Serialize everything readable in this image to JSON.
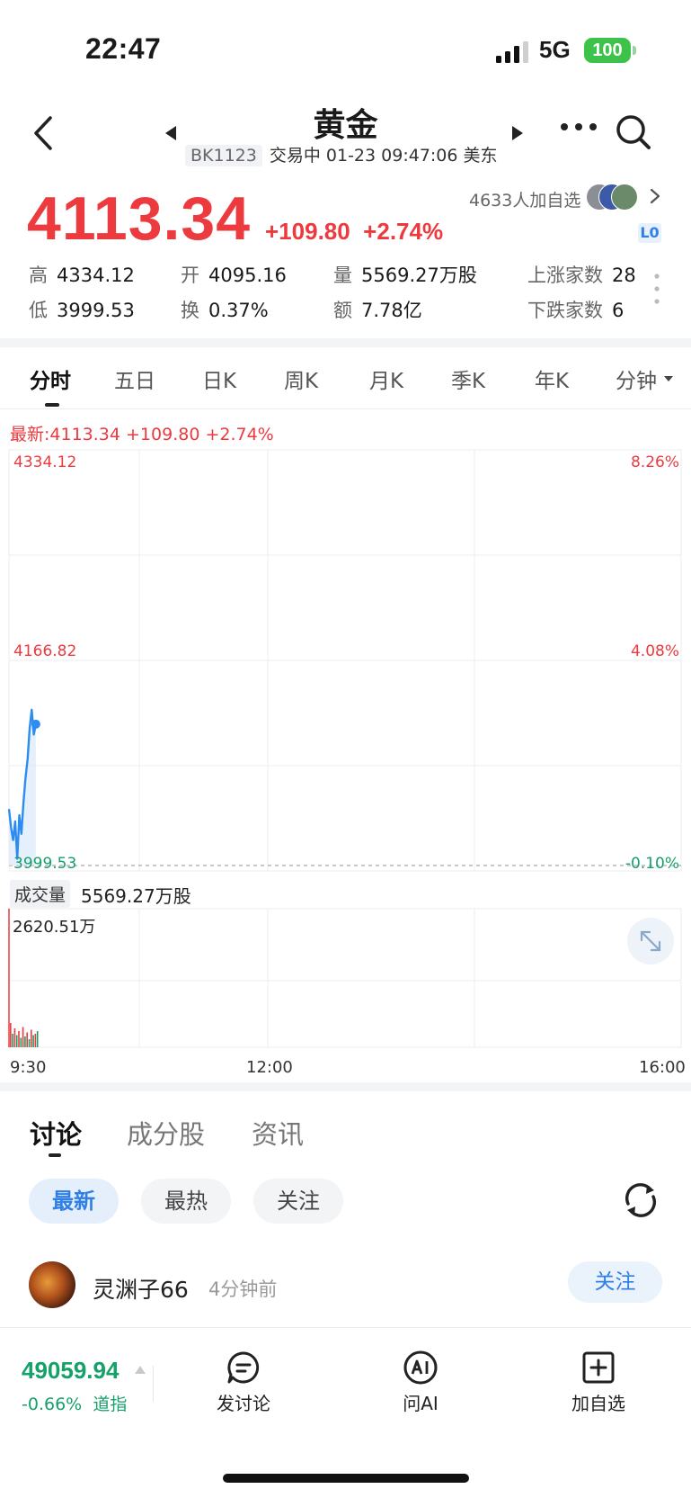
{
  "status_bar": {
    "time": "22:47",
    "network": "5G",
    "battery": "100"
  },
  "header": {
    "title": "黄金",
    "code": "BK1123",
    "status": "交易中 01-23 09:47:06 美东"
  },
  "quote": {
    "price": "4113.34",
    "change": "+109.80",
    "change_pct": "+2.74%",
    "followers": "4633人加自选",
    "level_badge": "L0"
  },
  "stats": {
    "high_label": "高",
    "high": "4334.12",
    "open_label": "开",
    "open": "4095.16",
    "volume_label": "量",
    "volume": "5569.27万股",
    "up_label": "上涨家数",
    "up": "28",
    "low_label": "低",
    "low": "3999.53",
    "turnover_label": "换",
    "turnover": "0.37%",
    "amount_label": "额",
    "amount": "7.78亿",
    "down_label": "下跌家数",
    "down": "6"
  },
  "chart_tabs": [
    "分时",
    "五日",
    "日K",
    "周K",
    "月K",
    "季K",
    "年K",
    "分钟"
  ],
  "latest_line": "最新:4113.34  +109.80  +2.74%",
  "chart_data": {
    "type": "line",
    "price_axis": {
      "top": "4334.12",
      "mid": "4166.82",
      "bottom": "3999.53"
    },
    "pct_axis": {
      "top": "8.26%",
      "mid": "4.08%",
      "bottom": "-0.10%"
    },
    "ylim": [
      3999.53,
      4334.12
    ],
    "x_ticks": [
      "9:30",
      "12:00",
      "16:00"
    ],
    "series": [
      {
        "values": [
          4045,
          4030,
          4020,
          4035,
          4005,
          4040,
          4025,
          4050,
          4070,
          4085,
          4110,
          4125,
          4105,
          4113.34
        ]
      }
    ],
    "volume": {
      "label": "成交量",
      "total": "5569.27万股",
      "max": "2620.51万",
      "bars": [
        18,
        10,
        14,
        9,
        12,
        7,
        15,
        8,
        11,
        6,
        13,
        9,
        10,
        12
      ]
    },
    "colors": {
      "line": "#2d8cf0",
      "up": "#ec3a3f",
      "down": "#16a06a"
    }
  },
  "discussion": {
    "tabs": [
      "讨论",
      "成分股",
      "资讯"
    ],
    "filters": [
      "最新",
      "最热",
      "关注"
    ],
    "post": {
      "user": "灵渊子66",
      "time": "4分钟前",
      "follow": "关注"
    }
  },
  "bottom_bar": {
    "index_value": "49059.94",
    "index_change": "-0.66%",
    "index_name": "道指",
    "actions": [
      "发讨论",
      "问AI",
      "加自选"
    ]
  }
}
